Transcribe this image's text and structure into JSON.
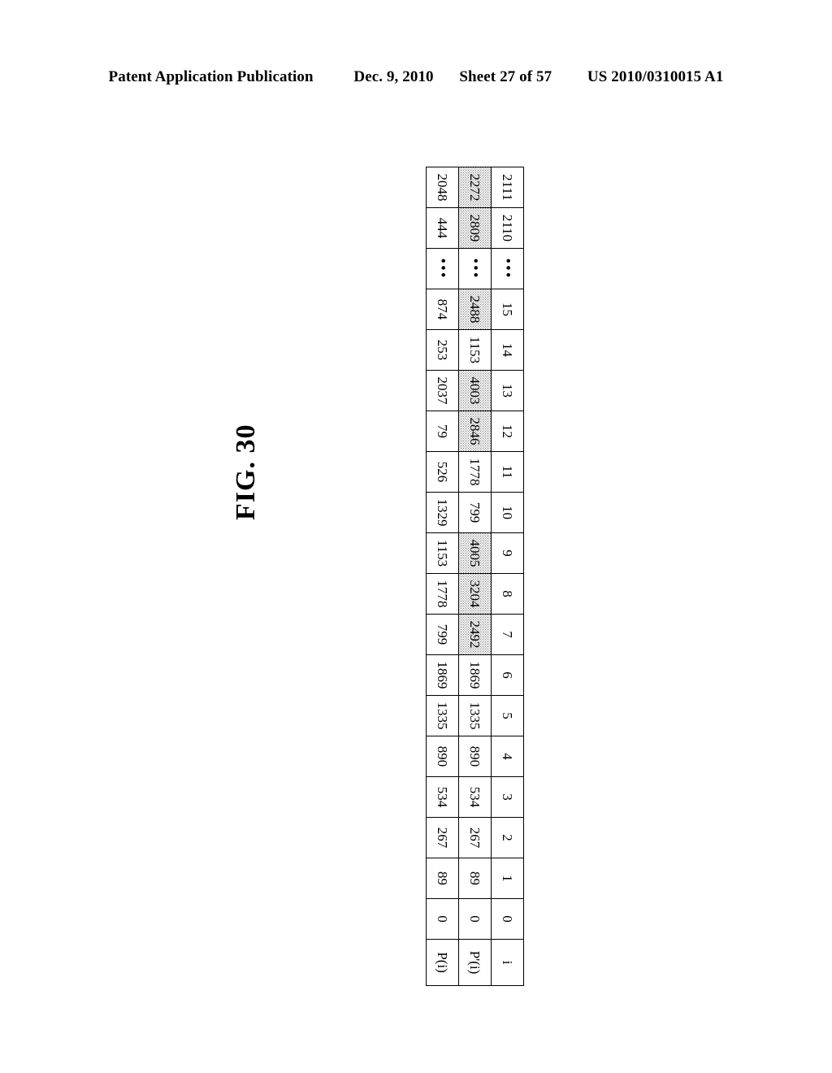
{
  "header": {
    "publication": "Patent Application Publication",
    "date": "Dec. 9, 2010",
    "sheet": "Sheet 27 of 57",
    "patent_number": "US 2010/0310015 A1"
  },
  "figure": {
    "title": "FIG. 30"
  },
  "table": {
    "row_labels": {
      "index": "i",
      "p_prime": "P'(i)",
      "p": "P(i)"
    },
    "ellipsis": "•••",
    "columns": [
      {
        "i": "0",
        "p_prime": "0",
        "p": "0",
        "shaded": false
      },
      {
        "i": "1",
        "p_prime": "89",
        "p": "89",
        "shaded": false
      },
      {
        "i": "2",
        "p_prime": "267",
        "p": "267",
        "shaded": false
      },
      {
        "i": "3",
        "p_prime": "534",
        "p": "534",
        "shaded": false
      },
      {
        "i": "4",
        "p_prime": "890",
        "p": "890",
        "shaded": false
      },
      {
        "i": "5",
        "p_prime": "1335",
        "p": "1335",
        "shaded": false
      },
      {
        "i": "6",
        "p_prime": "1869",
        "p": "1869",
        "shaded": false
      },
      {
        "i": "7",
        "p_prime": "2492",
        "p": "799",
        "shaded": true
      },
      {
        "i": "8",
        "p_prime": "3204",
        "p": "1778",
        "shaded": true
      },
      {
        "i": "9",
        "p_prime": "4005",
        "p": "1153",
        "shaded": true
      },
      {
        "i": "10",
        "p_prime": "799",
        "p": "1329",
        "shaded": false
      },
      {
        "i": "11",
        "p_prime": "1778",
        "p": "526",
        "shaded": false
      },
      {
        "i": "12",
        "p_prime": "2846",
        "p": "79",
        "shaded": true
      },
      {
        "i": "13",
        "p_prime": "4003",
        "p": "2037",
        "shaded": true
      },
      {
        "i": "14",
        "p_prime": "1153",
        "p": "253",
        "shaded": false
      },
      {
        "i": "15",
        "p_prime": "2488",
        "p": "874",
        "shaded": true
      },
      {
        "i": "ellipsis",
        "p_prime": "ellipsis",
        "p": "ellipsis",
        "shaded": false
      },
      {
        "i": "2110",
        "p_prime": "2809",
        "p": "444",
        "shaded": true
      },
      {
        "i": "2111",
        "p_prime": "2272",
        "p": "2048",
        "shaded": true
      }
    ]
  }
}
